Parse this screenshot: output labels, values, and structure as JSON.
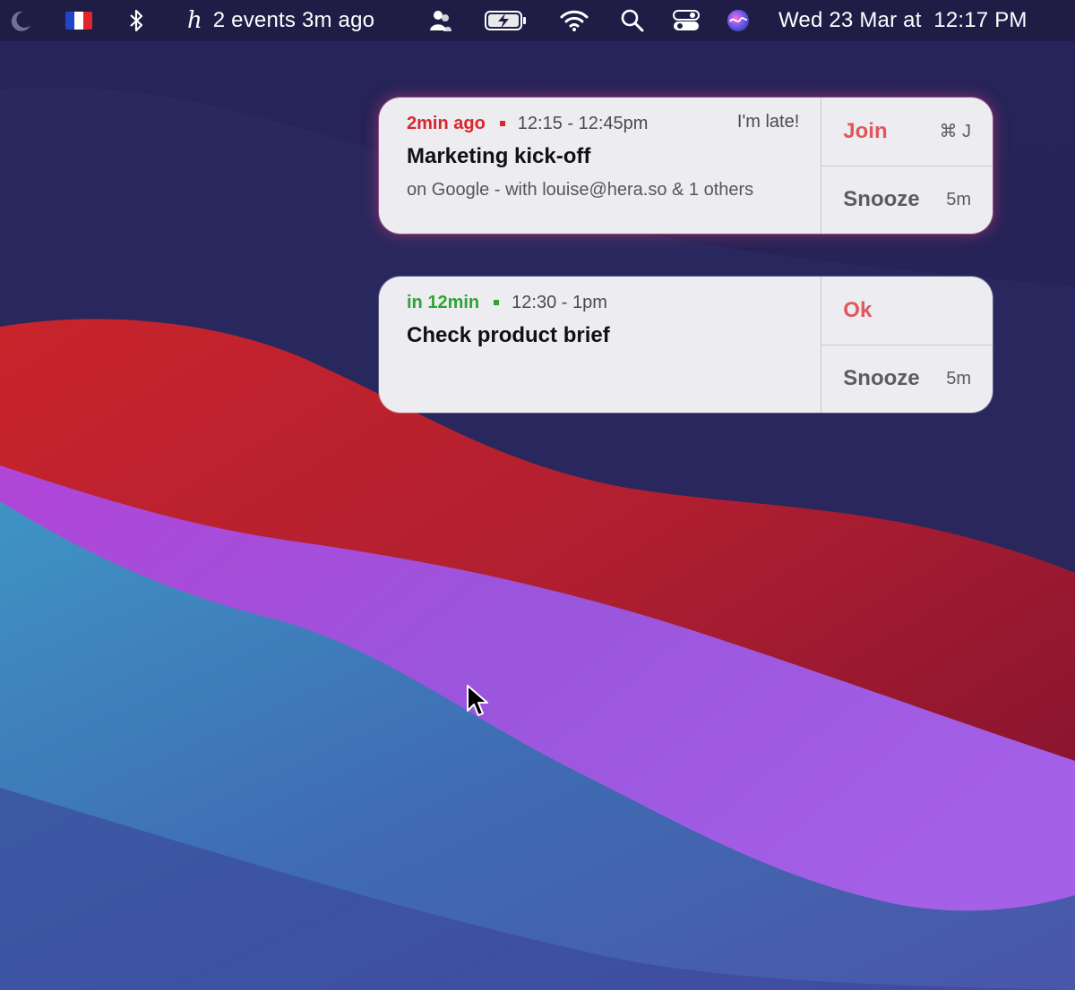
{
  "menubar": {
    "events_label": "2 events 3m ago",
    "datetime": "Wed 23 Mar at  12:17 PM",
    "icons": [
      "moon-icon",
      "french-flag-icon",
      "bluetooth-icon",
      "hera-logo-icon",
      "contacts-icon",
      "battery-charging-icon",
      "wifi-icon",
      "search-icon",
      "control-center-icon",
      "siri-icon"
    ]
  },
  "notifications": [
    {
      "relative": "2min ago",
      "relative_color": "#d9262b",
      "time": "12:15 - 12:45pm",
      "late": "I'm late!",
      "title": "Marketing kick-off",
      "subtitle": "on Google - with louise@hera.so & 1 others",
      "primary_action": "Join",
      "primary_shortcut": "⌘ J",
      "snooze_label": "Snooze",
      "snooze_time": "5m"
    },
    {
      "relative": "in 12min",
      "relative_color": "#2fa335",
      "time": "12:30 - 1pm",
      "title": "Check product brief",
      "primary_action": "Ok",
      "snooze_label": "Snooze",
      "snooze_time": "5m"
    }
  ],
  "colors": {
    "accent_red": "#e0575c",
    "status_red": "#d9262b",
    "status_green": "#2fa335",
    "card_bg": "#ececf1"
  }
}
